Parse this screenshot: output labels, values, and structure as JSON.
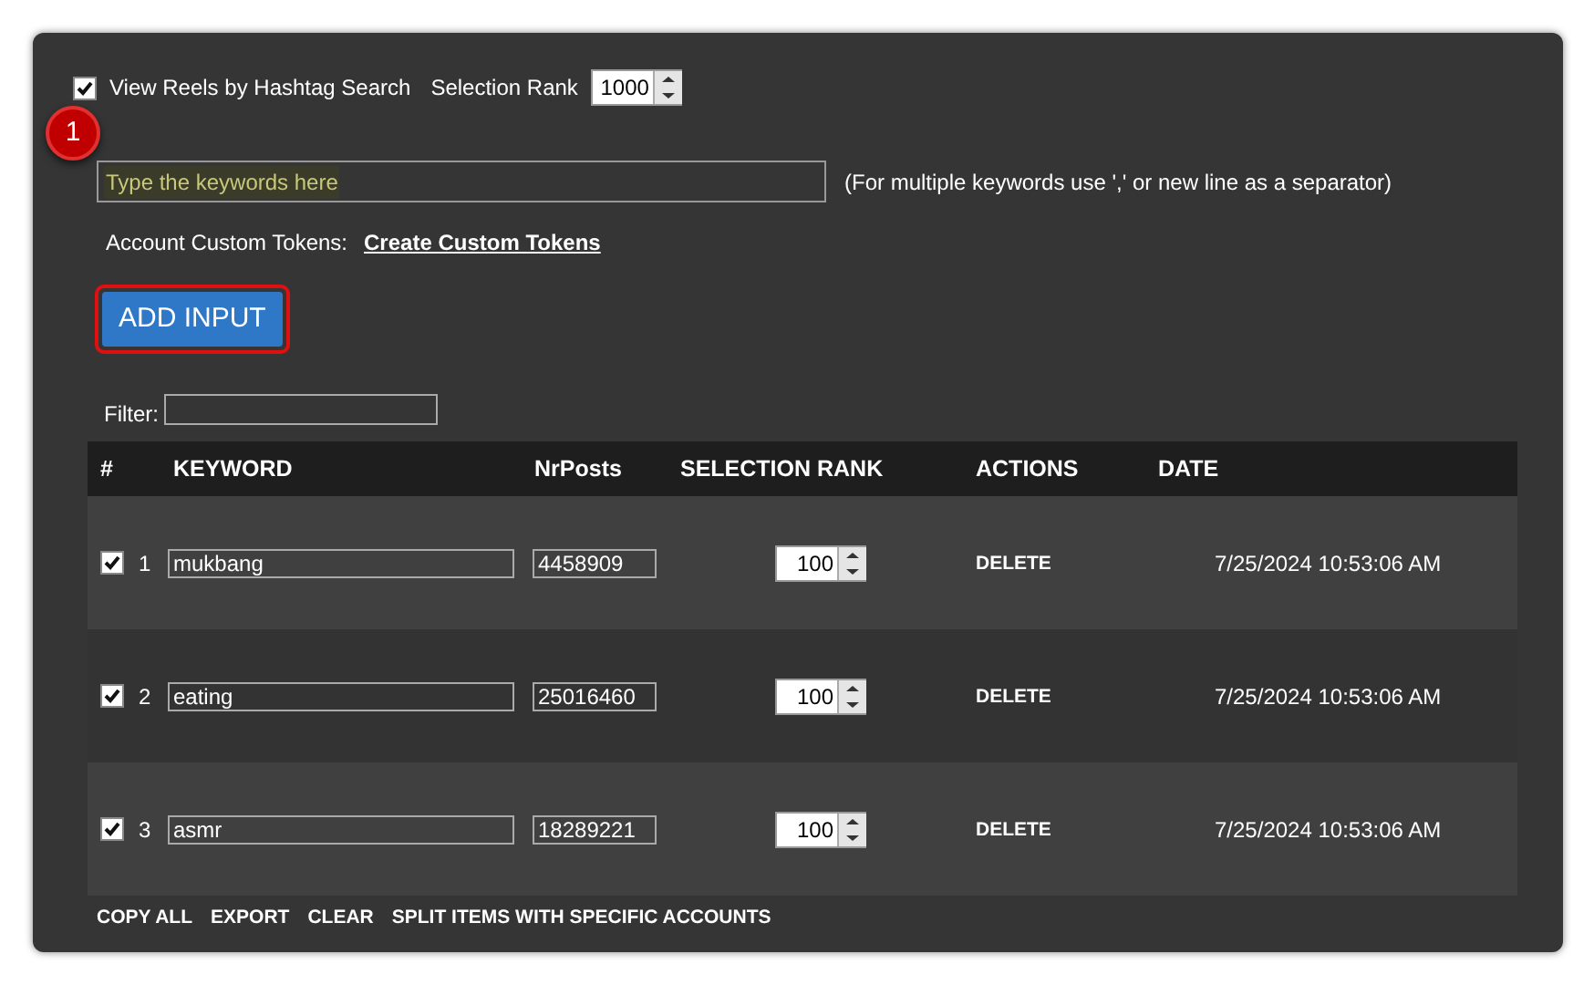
{
  "header": {
    "hashtag_search": {
      "label": "View Reels by Hashtag Search",
      "checked": true
    },
    "selection_rank": {
      "label": "Selection Rank",
      "value": "1000"
    }
  },
  "annotation": {
    "badge": "1"
  },
  "keywords_field": {
    "placeholder": "Type the keywords here",
    "hint": "(For multiple keywords use ',' or new line as a separator)"
  },
  "tokens": {
    "label": "Account Custom Tokens:",
    "link": "Create Custom Tokens"
  },
  "add_button": {
    "label": "ADD INPUT",
    "highlighted": true
  },
  "filter": {
    "label": "Filter:"
  },
  "table": {
    "columns": [
      "#",
      "KEYWORD",
      "NrPosts",
      "SELECTION RANK",
      "ACTIONS",
      "DATE"
    ],
    "rows": [
      {
        "checked": true,
        "number": "1",
        "keyword": "mukbang",
        "posts": "4458909",
        "rank": "100",
        "action": "DELETE",
        "date": "7/25/2024 10:53:06 AM"
      },
      {
        "checked": true,
        "number": "2",
        "keyword": "eating",
        "posts": "25016460",
        "rank": "100",
        "action": "DELETE",
        "date": "7/25/2024 10:53:06 AM"
      },
      {
        "checked": true,
        "number": "3",
        "keyword": "asmr",
        "posts": "18289221",
        "rank": "100",
        "action": "DELETE",
        "date": "7/25/2024 10:53:06 AM"
      }
    ]
  },
  "footer_actions": [
    "COPY ALL",
    "EXPORT",
    "CLEAR",
    "SPLIT ITEMS WITH SPECIFIC ACCOUNTS"
  ]
}
